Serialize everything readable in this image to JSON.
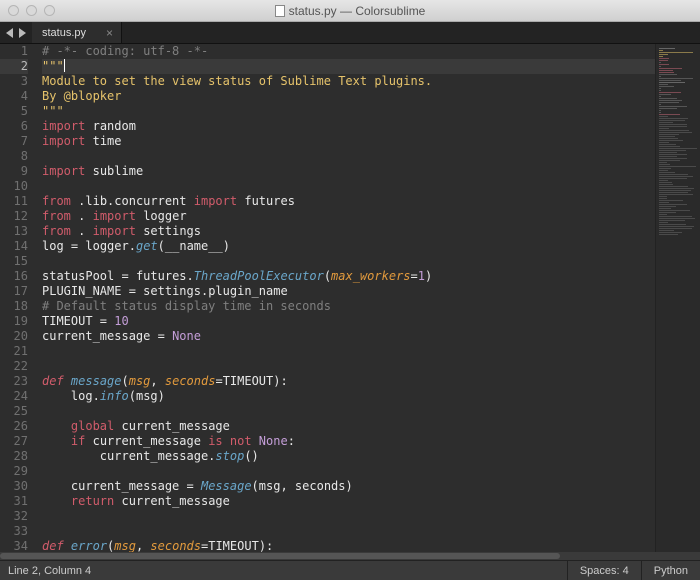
{
  "window": {
    "title": "status.py — Colorsublime"
  },
  "tabs": {
    "active": {
      "label": "status.py"
    }
  },
  "editor": {
    "current_line": 2,
    "lines": [
      {
        "n": 1,
        "tokens": [
          [
            "cm",
            "# -*- coding: utf-8 -*-"
          ]
        ]
      },
      {
        "n": 2,
        "tokens": [
          [
            "str",
            "\"\"\""
          ]
        ]
      },
      {
        "n": 3,
        "tokens": [
          [
            "str",
            "Module to set the view status of Sublime Text plugins."
          ]
        ]
      },
      {
        "n": 4,
        "tokens": [
          [
            "str",
            "By @blopker"
          ]
        ]
      },
      {
        "n": 5,
        "tokens": [
          [
            "str",
            "\"\"\""
          ]
        ]
      },
      {
        "n": 6,
        "tokens": [
          [
            "kw",
            "import"
          ],
          [
            "",
            " "
          ],
          [
            "mod",
            "random"
          ]
        ]
      },
      {
        "n": 7,
        "tokens": [
          [
            "kw",
            "import"
          ],
          [
            "",
            " "
          ],
          [
            "mod",
            "time"
          ]
        ]
      },
      {
        "n": 8,
        "tokens": []
      },
      {
        "n": 9,
        "tokens": [
          [
            "kw",
            "import"
          ],
          [
            "",
            " "
          ],
          [
            "mod",
            "sublime"
          ]
        ]
      },
      {
        "n": 10,
        "tokens": []
      },
      {
        "n": 11,
        "tokens": [
          [
            "kw",
            "from"
          ],
          [
            "",
            " "
          ],
          [
            "mod",
            ".lib.concurrent"
          ],
          [
            "",
            " "
          ],
          [
            "kw",
            "import"
          ],
          [
            "",
            " "
          ],
          [
            "mod",
            "futures"
          ]
        ]
      },
      {
        "n": 12,
        "tokens": [
          [
            "kw",
            "from"
          ],
          [
            "",
            " "
          ],
          [
            "mod",
            "."
          ],
          [
            "",
            " "
          ],
          [
            "kw",
            "import"
          ],
          [
            "",
            " "
          ],
          [
            "mod",
            "logger"
          ]
        ]
      },
      {
        "n": 13,
        "tokens": [
          [
            "kw",
            "from"
          ],
          [
            "",
            " "
          ],
          [
            "mod",
            "."
          ],
          [
            "",
            " "
          ],
          [
            "kw",
            "import"
          ],
          [
            "",
            " "
          ],
          [
            "mod",
            "settings"
          ]
        ]
      },
      {
        "n": 14,
        "tokens": [
          [
            "nm",
            "log "
          ],
          [
            "op",
            "="
          ],
          [
            "",
            " "
          ],
          [
            "nm",
            "logger"
          ],
          [
            "pun",
            "."
          ],
          [
            "fn",
            "get"
          ],
          [
            "pun",
            "("
          ],
          [
            "nm",
            "__name__"
          ],
          [
            "pun",
            ")"
          ]
        ]
      },
      {
        "n": 15,
        "tokens": []
      },
      {
        "n": 16,
        "tokens": [
          [
            "nm",
            "statusPool "
          ],
          [
            "op",
            "="
          ],
          [
            "",
            " "
          ],
          [
            "nm",
            "futures"
          ],
          [
            "pun",
            "."
          ],
          [
            "fn",
            "ThreadPoolExecutor"
          ],
          [
            "pun",
            "("
          ],
          [
            "arg",
            "max_workers"
          ],
          [
            "op",
            "="
          ],
          [
            "num",
            "1"
          ],
          [
            "pun",
            ")"
          ]
        ]
      },
      {
        "n": 17,
        "tokens": [
          [
            "nm",
            "PLUGIN_NAME "
          ],
          [
            "op",
            "="
          ],
          [
            "",
            " "
          ],
          [
            "nm",
            "settings"
          ],
          [
            "pun",
            "."
          ],
          [
            "nm",
            "plugin_name"
          ]
        ]
      },
      {
        "n": 18,
        "tokens": [
          [
            "cm",
            "# Default status display time in seconds"
          ]
        ]
      },
      {
        "n": 19,
        "tokens": [
          [
            "nm",
            "TIMEOUT "
          ],
          [
            "op",
            "="
          ],
          [
            "",
            " "
          ],
          [
            "num",
            "10"
          ]
        ]
      },
      {
        "n": 20,
        "tokens": [
          [
            "nm",
            "current_message "
          ],
          [
            "op",
            "="
          ],
          [
            "",
            " "
          ],
          [
            "con",
            "None"
          ]
        ]
      },
      {
        "n": 21,
        "tokens": []
      },
      {
        "n": 22,
        "tokens": []
      },
      {
        "n": 23,
        "tokens": [
          [
            "kw2",
            "def"
          ],
          [
            "",
            " "
          ],
          [
            "fn",
            "message"
          ],
          [
            "pun",
            "("
          ],
          [
            "arg",
            "msg"
          ],
          [
            "pun",
            ", "
          ],
          [
            "arg",
            "seconds"
          ],
          [
            "op",
            "="
          ],
          [
            "nm",
            "TIMEOUT"
          ],
          [
            "pun",
            "):"
          ]
        ]
      },
      {
        "n": 24,
        "tokens": [
          [
            "",
            "    "
          ],
          [
            "nm",
            "log"
          ],
          [
            "pun",
            "."
          ],
          [
            "fn",
            "info"
          ],
          [
            "pun",
            "("
          ],
          [
            "nm",
            "msg"
          ],
          [
            "pun",
            ")"
          ]
        ]
      },
      {
        "n": 25,
        "tokens": []
      },
      {
        "n": 26,
        "tokens": [
          [
            "",
            "    "
          ],
          [
            "kw",
            "global"
          ],
          [
            "",
            " "
          ],
          [
            "nm",
            "current_message"
          ]
        ]
      },
      {
        "n": 27,
        "tokens": [
          [
            "",
            "    "
          ],
          [
            "kw",
            "if"
          ],
          [
            "",
            " "
          ],
          [
            "nm",
            "current_message"
          ],
          [
            "",
            " "
          ],
          [
            "kw",
            "is not"
          ],
          [
            "",
            " "
          ],
          [
            "con",
            "None"
          ],
          [
            "pun",
            ":"
          ]
        ]
      },
      {
        "n": 28,
        "tokens": [
          [
            "",
            "        "
          ],
          [
            "nm",
            "current_message"
          ],
          [
            "pun",
            "."
          ],
          [
            "fn",
            "stop"
          ],
          [
            "pun",
            "()"
          ]
        ]
      },
      {
        "n": 29,
        "tokens": []
      },
      {
        "n": 30,
        "tokens": [
          [
            "",
            "    "
          ],
          [
            "nm",
            "current_message "
          ],
          [
            "op",
            "="
          ],
          [
            "",
            " "
          ],
          [
            "fn",
            "Message"
          ],
          [
            "pun",
            "("
          ],
          [
            "nm",
            "msg"
          ],
          [
            "pun",
            ", "
          ],
          [
            "nm",
            "seconds"
          ],
          [
            "pun",
            ")"
          ]
        ]
      },
      {
        "n": 31,
        "tokens": [
          [
            "",
            "    "
          ],
          [
            "kw",
            "return"
          ],
          [
            "",
            " "
          ],
          [
            "nm",
            "current_message"
          ]
        ]
      },
      {
        "n": 32,
        "tokens": []
      },
      {
        "n": 33,
        "tokens": []
      },
      {
        "n": 34,
        "tokens": [
          [
            "kw2",
            "def"
          ],
          [
            "",
            " "
          ],
          [
            "fn",
            "error"
          ],
          [
            "pun",
            "("
          ],
          [
            "arg",
            "msg"
          ],
          [
            "pun",
            ", "
          ],
          [
            "arg",
            "seconds"
          ],
          [
            "op",
            "="
          ],
          [
            "nm",
            "TIMEOUT"
          ],
          [
            "pun",
            "):"
          ]
        ]
      }
    ]
  },
  "status": {
    "position": "Line 2, Column 4",
    "indent": "Spaces: 4",
    "syntax": "Python"
  },
  "colors": {
    "bg": "#2d2d2d",
    "gutter": "#707070",
    "keyword": "#d15c6b",
    "string": "#e6c36b",
    "comment": "#7f7f7f",
    "func": "#6aa6c9",
    "param": "#e29a3d",
    "number": "#c49ed8"
  }
}
